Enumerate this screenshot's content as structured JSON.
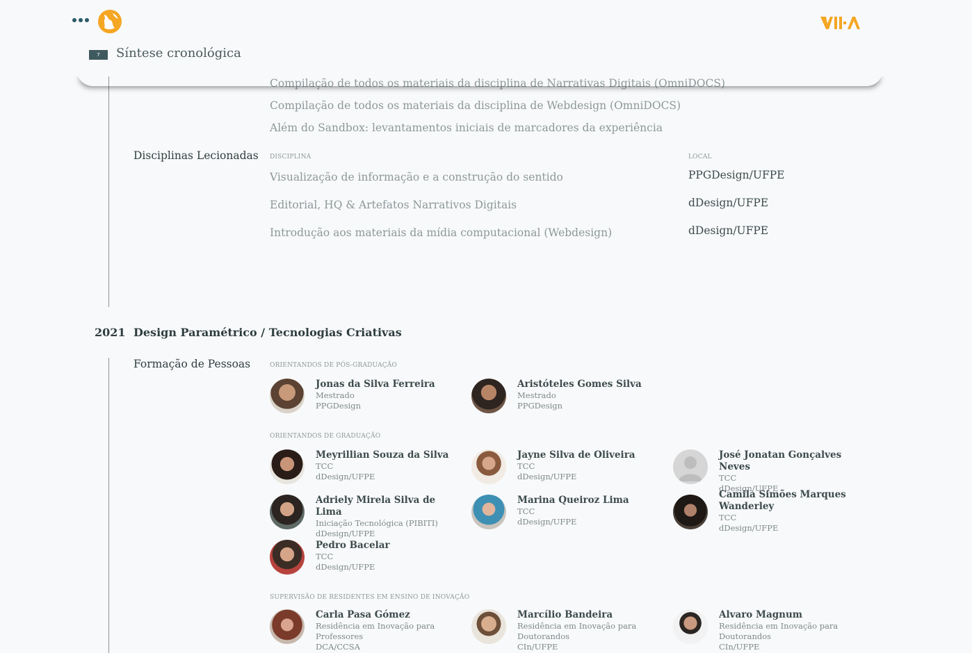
{
  "header": {
    "section_number": "7",
    "section_title": "Síntese cronológica",
    "menu_icon": "dots-menu-icon",
    "logo_icon": "globe-logo-icon",
    "brand_icon": "brand-logo-icon",
    "brand_color": "#f5a623"
  },
  "materials": [
    "Compilação de todos os materiais da disciplina de Narrativas Digitais (OmniDOCS)",
    "Compilação de todos os materiais da disciplina de Webdesign (OmniDOCS)",
    "Além do Sandbox: levantamentos iniciais de marcadores da experiência"
  ],
  "disciplinas": {
    "label": "Disciplinas Lecionadas",
    "col_discipline": "DISCIPLINA",
    "col_local": "LOCAL",
    "rows": [
      {
        "name": "Visualização de informação e a construção do sentido",
        "local": "PPGDesign/UFPE"
      },
      {
        "name": "Editorial, HQ & Artefatos Narrativos Digitais",
        "local": "dDesign/UFPE"
      },
      {
        "name": "Introdução aos materiais da mídia computacional (Webdesign)",
        "local": "dDesign/UFPE"
      }
    ]
  },
  "year_block": {
    "year": "2021",
    "title": "Design Paramétrico / Tecnologias Criativas",
    "formacao_label": "Formação de Pessoas",
    "groups": [
      {
        "heading": "ORIENTANDOS DE PÓS-GRADUAÇÃO",
        "people": [
          {
            "name": "Jonas da Silva Ferreira",
            "lines": [
              "Mestrado",
              "PPGDesign"
            ]
          },
          {
            "name": "Aristóteles Gomes Silva",
            "lines": [
              "Mestrado",
              "PPGDesign"
            ]
          }
        ]
      },
      {
        "heading": "ORIENTANDOS DE GRADUAÇÃO",
        "people": [
          {
            "name": "Meyrillian Souza da Silva",
            "lines": [
              "TCC",
              "dDesign/UFPE"
            ]
          },
          {
            "name": "Jayne Silva de Oliveira",
            "lines": [
              "TCC",
              "dDesign/UFPE"
            ]
          },
          {
            "name": "José Jonatan Gonçalves Neves",
            "lines": [
              "TCC",
              "dDesign/UFPE"
            ]
          },
          {
            "name": "Adriely Mirela Silva de Lima",
            "lines": [
              "Iniciação Tecnológica (PIBITI)",
              "dDesign/UFPE"
            ]
          },
          {
            "name": "Marina Queiroz Lima",
            "lines": [
              "TCC",
              "dDesign/UFPE"
            ]
          },
          {
            "name": "Camila Simões Marques Wanderley",
            "lines": [
              "TCC",
              "dDesign/UFPE"
            ]
          },
          {
            "name": "Pedro Bacelar",
            "lines": [
              "TCC",
              "dDesign/UFPE"
            ]
          }
        ]
      },
      {
        "heading": "SUPERVISÃO DE RESIDENTES EM ENSINO DE INOVAÇÃO",
        "people": [
          {
            "name": "Carla Pasa Gómez",
            "lines": [
              "Residência em Inovação para",
              "Professores",
              "DCA/CCSA"
            ]
          },
          {
            "name": "Marcílio Bandeira",
            "lines": [
              "Residência em Inovação para",
              "Doutorandos",
              "CIn/UFPE"
            ]
          },
          {
            "name": "Alvaro Magnum",
            "lines": [
              "Residência em Inovação para",
              "Doutorandos",
              "CIn/UFPE"
            ]
          }
        ]
      }
    ]
  }
}
